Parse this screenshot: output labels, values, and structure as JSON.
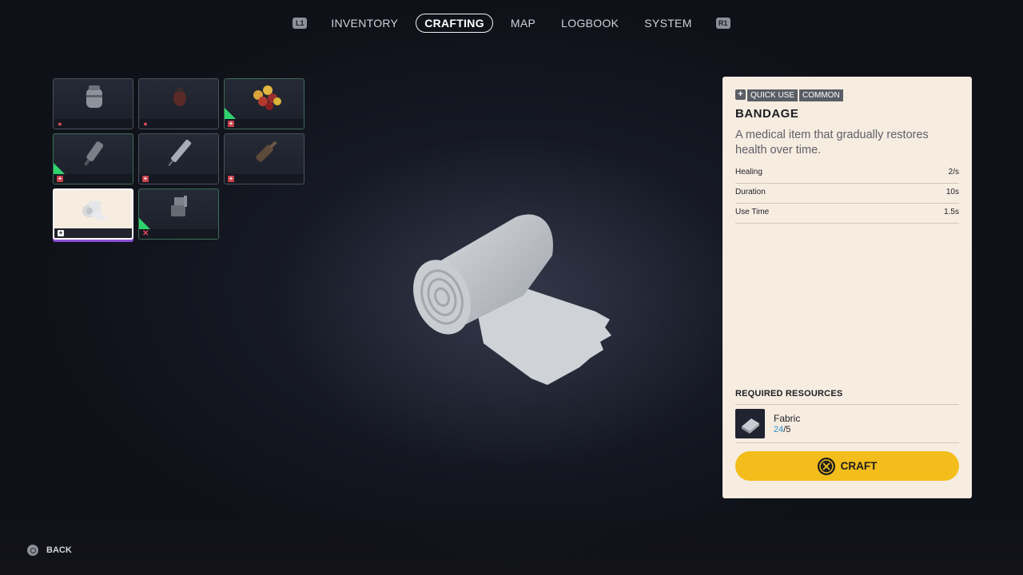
{
  "nav": {
    "left_button": "L1",
    "right_button": "R1",
    "tabs": [
      {
        "label": "INVENTORY",
        "active": false
      },
      {
        "label": "CRAFTING",
        "active": true
      },
      {
        "label": "MAP",
        "active": false
      },
      {
        "label": "LOGBOOK",
        "active": false
      },
      {
        "label": "SYSTEM",
        "active": false
      }
    ]
  },
  "grid": {
    "slots": [
      {
        "icon": "canister-icon",
        "badge": "pill",
        "rarity": "common"
      },
      {
        "icon": "grenade-icon",
        "badge": "pill",
        "rarity": "common"
      },
      {
        "icon": "food-pile-icon",
        "badge": "med",
        "rarity": "rare"
      },
      {
        "icon": "injector-icon",
        "badge": "med",
        "rarity": "rare"
      },
      {
        "icon": "syringe-icon",
        "badge": "med",
        "rarity": "common"
      },
      {
        "icon": "bottle-icon",
        "badge": "med",
        "rarity": "common"
      },
      {
        "icon": "bandage-roll-icon",
        "badge": "plus-white",
        "rarity": "common",
        "selected": true
      },
      {
        "icon": "turret-icon",
        "badge": "cross",
        "rarity": "rare"
      }
    ]
  },
  "details": {
    "tags": [
      "QUICK USE",
      "COMMON"
    ],
    "name": "BANDAGE",
    "description": "A medical item that gradually restores health over time.",
    "stats": [
      {
        "label": "Healing",
        "value": "2/s"
      },
      {
        "label": "Duration",
        "value": "10s"
      },
      {
        "label": "Use Time",
        "value": "1.5s"
      }
    ],
    "required_title": "REQUIRED RESOURCES",
    "resource": {
      "name": "Fabric",
      "have": "24",
      "need": "/5"
    },
    "craft_label": "CRAFT"
  },
  "footer": {
    "back_label": "BACK"
  },
  "colors": {
    "accent": "#f3bd1b",
    "panel": "#f6ece0",
    "rare": "#2fd36d",
    "selected_underline": "#8a50d8"
  }
}
